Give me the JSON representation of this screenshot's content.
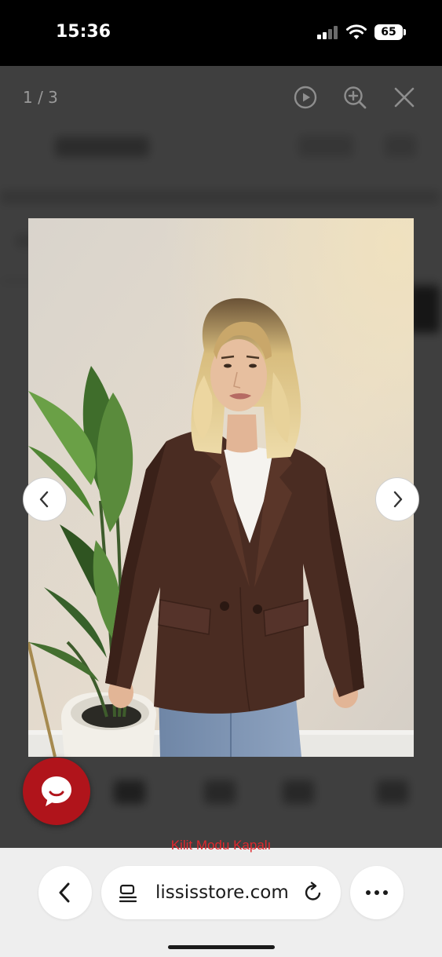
{
  "status_bar": {
    "time": "15:36",
    "battery": "65",
    "icons": [
      "cellular-signal-icon",
      "wifi-icon",
      "battery-icon"
    ]
  },
  "lightbox": {
    "counter": "1 / 3",
    "controls": [
      "play-icon",
      "zoom-in-icon",
      "close-icon"
    ],
    "image": {
      "current_index": 1,
      "total": 3
    },
    "nav": [
      "chevron-left-icon",
      "chevron-right-icon"
    ]
  },
  "chat": {
    "icon": "chat-bubble-icon"
  },
  "browser": {
    "lock_mode_text": "Kilit Modu Kapalı",
    "url": "lississtore.com",
    "icons": [
      "back-icon",
      "page-settings-icon",
      "reload-icon",
      "more-icon"
    ]
  },
  "colors": {
    "chat_accent": "#b0141b",
    "lock_mode_text": "#e0282e",
    "overlay": "#3a3a3a"
  }
}
